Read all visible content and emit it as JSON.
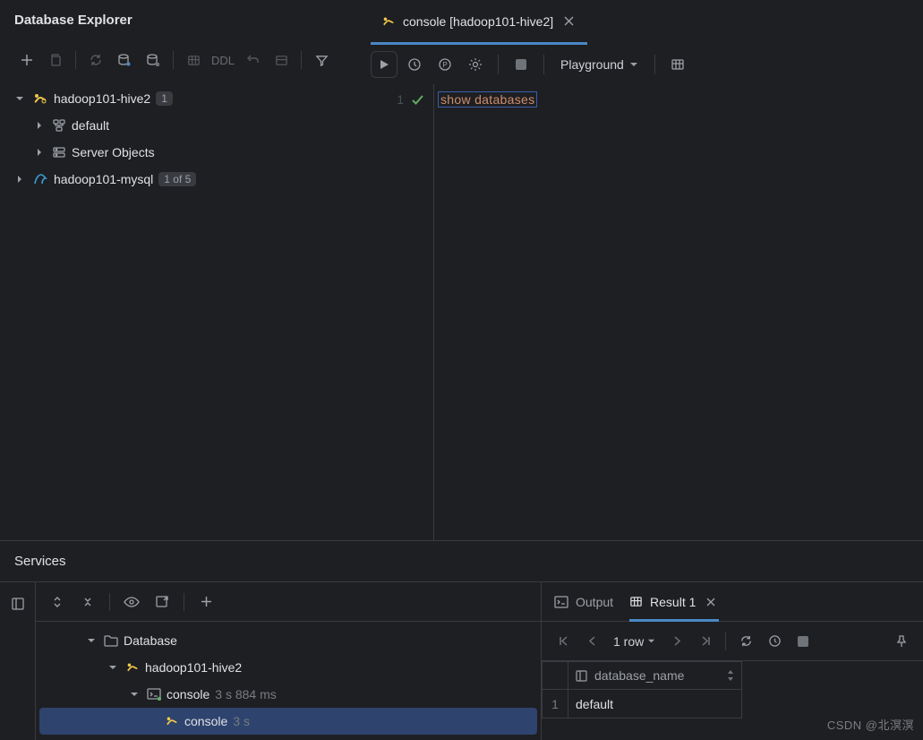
{
  "db_panel": {
    "title": "Database Explorer",
    "ddl_label": "DDL",
    "tree": {
      "hive": {
        "name": "hadoop101-hive2",
        "badge": "1",
        "schema_default": "default",
        "server_objects": "Server Objects"
      },
      "mysql": {
        "name": "hadoop101-mysql",
        "badge": "1 of 5"
      }
    }
  },
  "editor": {
    "tab_label": "console [hadoop101-hive2]",
    "playground": "Playground",
    "line_no": "1",
    "code": {
      "kw1": "show",
      "kw2": "databases"
    },
    "sql": "show databases"
  },
  "services": {
    "title": "Services",
    "tree": {
      "root": "Database",
      "conn": "hadoop101-hive2",
      "console": "console",
      "console_time": "3 s 884 ms",
      "leaf": "console",
      "leaf_time": "3 s"
    },
    "tabs": {
      "output": "Output",
      "result": "Result 1"
    },
    "result": {
      "row_count": "1 row",
      "col_name": "database_name",
      "row_idx": "1",
      "row_val": "default"
    }
  },
  "watermark": "CSDN @北溟溟",
  "chart_data": {
    "type": "table",
    "title": "Result 1",
    "columns": [
      "database_name"
    ],
    "rows": [
      [
        "default"
      ]
    ]
  }
}
